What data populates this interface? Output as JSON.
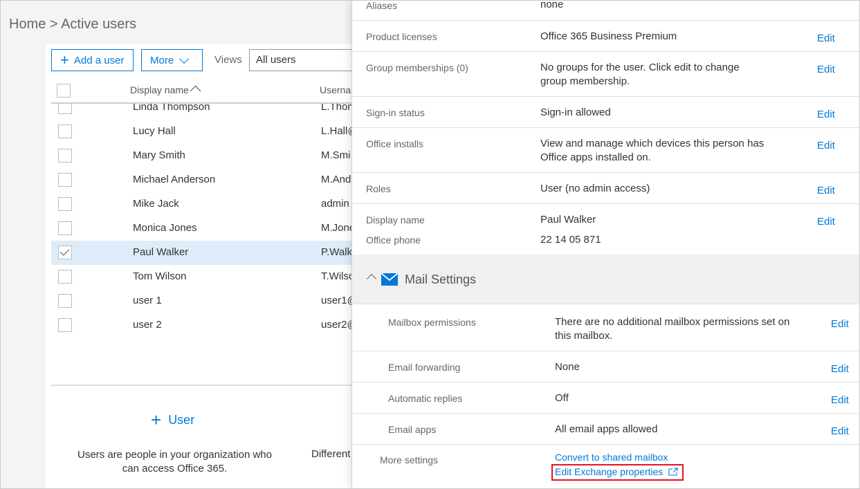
{
  "breadcrumb": {
    "home": "Home",
    "separator": ">",
    "current": "Active users"
  },
  "toolbar": {
    "add_user_label": "Add a user",
    "more_label": "More",
    "views_label": "Views",
    "views_value": "All users"
  },
  "grid": {
    "columns": {
      "display_name": "Display name",
      "username": "Userna"
    },
    "rows": [
      {
        "name": "Linda Thompson",
        "username": "L.Thom",
        "selected": false
      },
      {
        "name": "Lucy Hall",
        "username": "L.Hall@",
        "selected": false
      },
      {
        "name": "Mary Smith",
        "username": "M.Smi",
        "selected": false
      },
      {
        "name": "Michael Anderson",
        "username": "M.And",
        "selected": false
      },
      {
        "name": "Mike Jack",
        "username": "admin",
        "selected": false
      },
      {
        "name": "Monica Jones",
        "username": "M.Jone",
        "selected": false
      },
      {
        "name": "Paul Walker",
        "username": "P.Walk",
        "selected": true
      },
      {
        "name": "Tom Wilson",
        "username": "T.Wilso",
        "selected": false
      },
      {
        "name": "user 1",
        "username": "user1@",
        "selected": false
      },
      {
        "name": "user 2",
        "username": "user2@",
        "selected": false
      }
    ]
  },
  "empty_state": {
    "add_user": "User",
    "description": "Users are people in your organization who can access Office 365.",
    "description2": "Different"
  },
  "panel": {
    "rows": [
      {
        "label": "Aliases",
        "value": "none",
        "edit": ""
      },
      {
        "label": "Product licenses",
        "value": "Office 365 Business Premium",
        "edit": "Edit"
      },
      {
        "label": "Group memberships (0)",
        "value": "No groups for the user. Click edit to change group membership.",
        "edit": "Edit"
      },
      {
        "label": "Sign-in status",
        "value": "Sign-in allowed",
        "edit": "Edit"
      },
      {
        "label": "Office installs",
        "value": "View and manage which devices this person has Office apps installed on.",
        "edit": "Edit"
      },
      {
        "label": "Roles",
        "value": "User (no admin access)",
        "edit": "Edit"
      }
    ],
    "contact": {
      "display_name_label": "Display name",
      "display_name_value": "Paul Walker",
      "office_phone_label": "Office phone",
      "office_phone_value": "22 14 05 871",
      "edit": "Edit"
    },
    "mail": {
      "title": "Mail Settings",
      "rows": [
        {
          "label": "Mailbox permissions",
          "value": "There are no additional mailbox permissions set on this mailbox.",
          "edit": "Edit"
        },
        {
          "label": "Email forwarding",
          "value": "None",
          "edit": "Edit"
        },
        {
          "label": "Automatic replies",
          "value": "Off",
          "edit": "Edit"
        },
        {
          "label": "Email apps",
          "value": "All email apps allowed",
          "edit": "Edit"
        }
      ],
      "more_settings_label": "More settings",
      "convert_link": "Convert to shared mailbox",
      "exchange_link": "Edit Exchange properties"
    }
  },
  "colors": {
    "accent": "#0078d7",
    "highlight": "#e81123",
    "selected_row": "#deecf9"
  }
}
